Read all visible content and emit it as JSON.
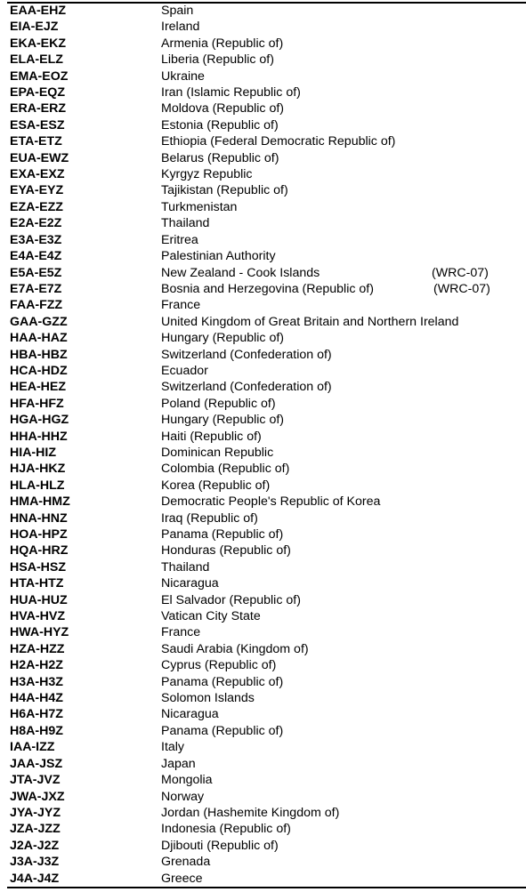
{
  "table": {
    "rows": [
      {
        "code": "EAA-EHZ",
        "name": "Spain"
      },
      {
        "code": "EIA-EJZ",
        "name": "Ireland"
      },
      {
        "code": "EKA-EKZ",
        "name": "Armenia (Republic of)"
      },
      {
        "code": "ELA-ELZ",
        "name": "Liberia (Republic of)"
      },
      {
        "code": "EMA-EOZ",
        "name": "Ukraine"
      },
      {
        "code": "EPA-EQZ",
        "name": "Iran (Islamic Republic of)"
      },
      {
        "code": "ERA-ERZ",
        "name": "Moldova (Republic of)"
      },
      {
        "code": "ESA-ESZ",
        "name": "Estonia (Republic of)"
      },
      {
        "code": "ETA-ETZ",
        "name": "Ethiopia (Federal Democratic Republic of)"
      },
      {
        "code": "EUA-EWZ",
        "name": "Belarus (Republic of)"
      },
      {
        "code": "EXA-EXZ",
        "name": "Kyrgyz Republic"
      },
      {
        "code": "EYA-EYZ",
        "name": "Tajikistan (Republic of)"
      },
      {
        "code": "EZA-EZZ",
        "name": "Turkmenistan"
      },
      {
        "code": "E2A-E2Z",
        "name": "Thailand"
      },
      {
        "code": "E3A-E3Z",
        "name": "Eritrea"
      },
      {
        "code": "E4A-E4Z",
        "name": "Palestinian Authority"
      },
      {
        "code": "E5A-E5Z",
        "name": "New Zealand - Cook Islands",
        "note": "(WRC-07)"
      },
      {
        "code": "E7A-E7Z",
        "name": "Bosnia and Herzegovina (Republic of)",
        "note": "(WRC-07)"
      },
      {
        "code": "FAA-FZZ",
        "name": "France"
      },
      {
        "code": "GAA-GZZ",
        "name": "United Kingdom of Great Britain and Northern Ireland"
      },
      {
        "code": "HAA-HAZ",
        "name": "Hungary (Republic of)"
      },
      {
        "code": "HBA-HBZ",
        "name": "Switzerland (Confederation of)"
      },
      {
        "code": "HCA-HDZ",
        "name": "Ecuador"
      },
      {
        "code": "HEA-HEZ",
        "name": "Switzerland (Confederation of)"
      },
      {
        "code": "HFA-HFZ",
        "name": "Poland (Republic of)"
      },
      {
        "code": "HGA-HGZ",
        "name": "Hungary (Republic of)"
      },
      {
        "code": "HHA-HHZ",
        "name": "Haiti (Republic of)"
      },
      {
        "code": "HIA-HIZ",
        "name": "Dominican Republic"
      },
      {
        "code": "HJA-HKZ",
        "name": "Colombia (Republic of)"
      },
      {
        "code": "HLA-HLZ",
        "name": "Korea (Republic of)"
      },
      {
        "code": "HMA-HMZ",
        "name": "Democratic People's Republic of Korea"
      },
      {
        "code": "HNA-HNZ",
        "name": "Iraq (Republic of)"
      },
      {
        "code": "HOA-HPZ",
        "name": "Panama (Republic of)"
      },
      {
        "code": "HQA-HRZ",
        "name": "Honduras (Republic of)"
      },
      {
        "code": "HSA-HSZ",
        "name": "Thailand"
      },
      {
        "code": "HTA-HTZ",
        "name": "Nicaragua"
      },
      {
        "code": "HUA-HUZ",
        "name": "El Salvador (Republic of)"
      },
      {
        "code": "HVA-HVZ",
        "name": "Vatican City State"
      },
      {
        "code": "HWA-HYZ",
        "name": "France"
      },
      {
        "code": "HZA-HZZ",
        "name": "Saudi Arabia (Kingdom of)"
      },
      {
        "code": "H2A-H2Z",
        "name": "Cyprus (Republic of)"
      },
      {
        "code": "H3A-H3Z",
        "name": "Panama (Republic of)"
      },
      {
        "code": "H4A-H4Z",
        "name": "Solomon Islands"
      },
      {
        "code": "H6A-H7Z",
        "name": "Nicaragua"
      },
      {
        "code": "H8A-H9Z",
        "name": "Panama (Republic of)"
      },
      {
        "code": "IAA-IZZ",
        "name": "Italy"
      },
      {
        "code": "JAA-JSZ",
        "name": "Japan"
      },
      {
        "code": "JTA-JVZ",
        "name": "Mongolia"
      },
      {
        "code": "JWA-JXZ",
        "name": "Norway"
      },
      {
        "code": "JYA-JYZ",
        "name": "Jordan (Hashemite Kingdom of)"
      },
      {
        "code": "JZA-JZZ",
        "name": "Indonesia (Republic of)"
      },
      {
        "code": "J2A-J2Z",
        "name": "Djibouti (Republic of)"
      },
      {
        "code": "J3A-J3Z",
        "name": "Grenada"
      },
      {
        "code": "J4A-J4Z",
        "name": "Greece"
      }
    ]
  }
}
